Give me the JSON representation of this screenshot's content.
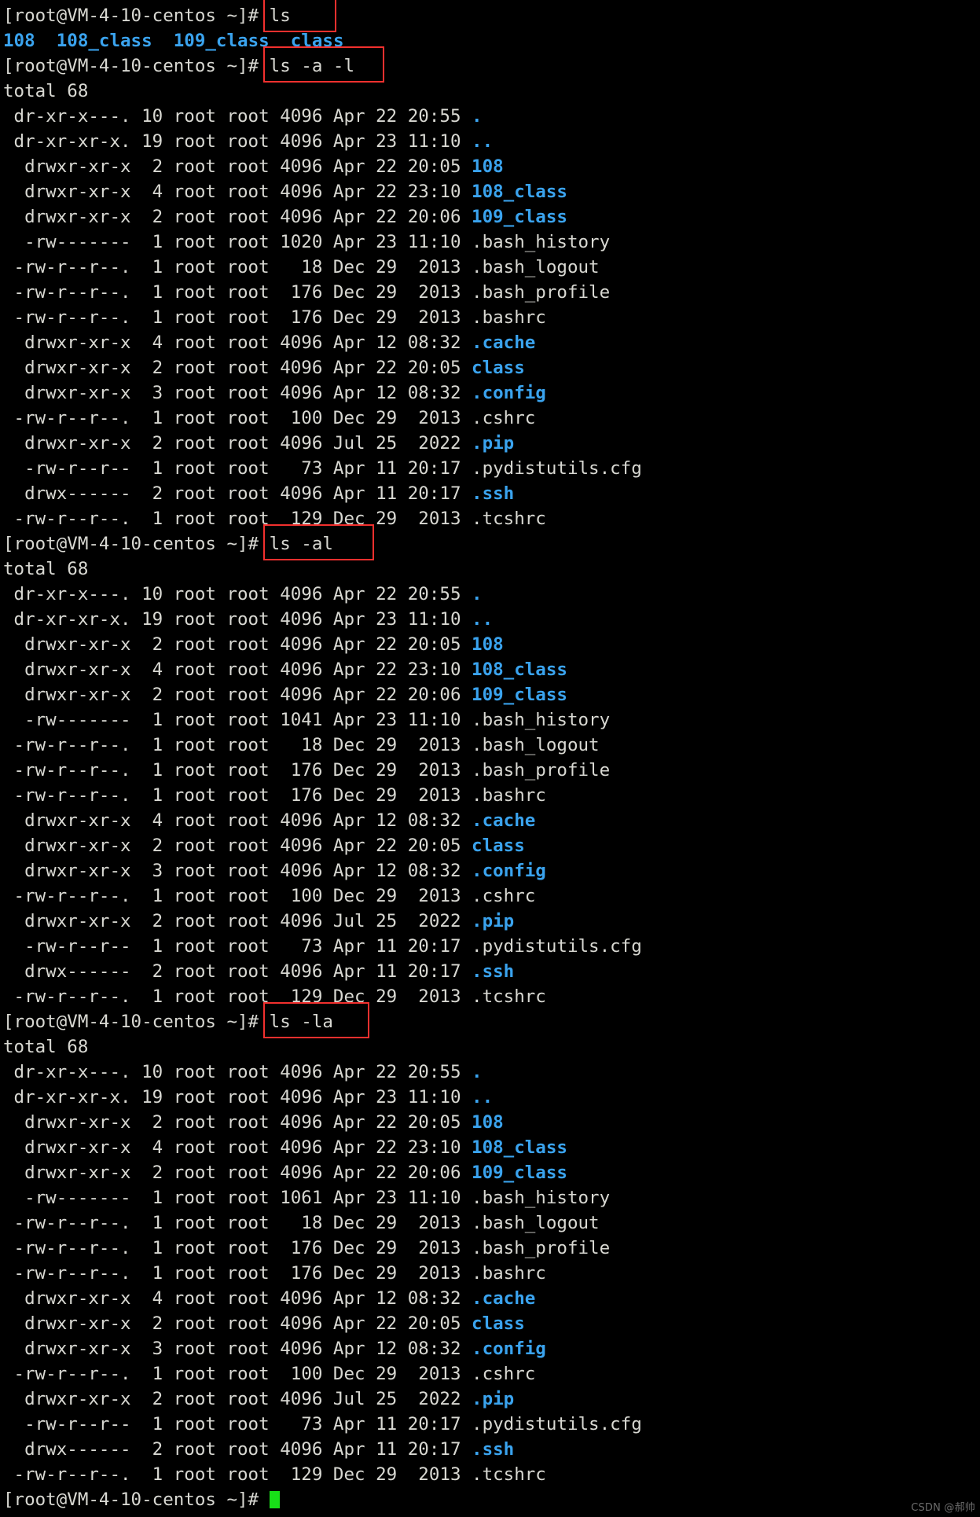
{
  "terminal": {
    "prompt": "[root@VM-4-10-centos ~]# ",
    "colors": {
      "background": "#000000",
      "foreground": "#d8d8d2",
      "directory": "#3aa3ee",
      "annotation_box": "#f2302e",
      "cursor": "#18e018"
    },
    "watermark": "CSDN @郝帅",
    "blocks": [
      {
        "command": "ls",
        "boxed": true,
        "output": [
          {
            "type": "names",
            "items": [
              {
                "text": "108",
                "dir": true
              },
              {
                "text": "108_class",
                "dir": true
              },
              {
                "text": "109_class",
                "dir": true
              },
              {
                "text": "class",
                "dir": true
              }
            ]
          }
        ]
      },
      {
        "command": "ls -a -l",
        "boxed": true,
        "total": "total 68",
        "rows": [
          {
            "perm": "dr-xr-x---.",
            "links": "10",
            "user": "root",
            "group": "root",
            "size": "4096",
            "month": "Apr",
            "day": "22",
            "time": "20:55",
            "name": ".",
            "dir": true
          },
          {
            "perm": "dr-xr-xr-x.",
            "links": "19",
            "user": "root",
            "group": "root",
            "size": "4096",
            "month": "Apr",
            "day": "23",
            "time": "11:10",
            "name": "..",
            "dir": true
          },
          {
            "perm": "drwxr-xr-x",
            "links": "2",
            "user": "root",
            "group": "root",
            "size": "4096",
            "month": "Apr",
            "day": "22",
            "time": "20:05",
            "name": "108",
            "dir": true
          },
          {
            "perm": "drwxr-xr-x",
            "links": "4",
            "user": "root",
            "group": "root",
            "size": "4096",
            "month": "Apr",
            "day": "22",
            "time": "23:10",
            "name": "108_class",
            "dir": true
          },
          {
            "perm": "drwxr-xr-x",
            "links": "2",
            "user": "root",
            "group": "root",
            "size": "4096",
            "month": "Apr",
            "day": "22",
            "time": "20:06",
            "name": "109_class",
            "dir": true
          },
          {
            "perm": "-rw-------",
            "links": "1",
            "user": "root",
            "group": "root",
            "size": "1020",
            "month": "Apr",
            "day": "23",
            "time": "11:10",
            "name": ".bash_history",
            "dir": false
          },
          {
            "perm": "-rw-r--r--.",
            "links": "1",
            "user": "root",
            "group": "root",
            "size": "18",
            "month": "Dec",
            "day": "29",
            "time": "2013",
            "name": ".bash_logout",
            "dir": false
          },
          {
            "perm": "-rw-r--r--.",
            "links": "1",
            "user": "root",
            "group": "root",
            "size": "176",
            "month": "Dec",
            "day": "29",
            "time": "2013",
            "name": ".bash_profile",
            "dir": false
          },
          {
            "perm": "-rw-r--r--.",
            "links": "1",
            "user": "root",
            "group": "root",
            "size": "176",
            "month": "Dec",
            "day": "29",
            "time": "2013",
            "name": ".bashrc",
            "dir": false
          },
          {
            "perm": "drwxr-xr-x",
            "links": "4",
            "user": "root",
            "group": "root",
            "size": "4096",
            "month": "Apr",
            "day": "12",
            "time": "08:32",
            "name": ".cache",
            "dir": true
          },
          {
            "perm": "drwxr-xr-x",
            "links": "2",
            "user": "root",
            "group": "root",
            "size": "4096",
            "month": "Apr",
            "day": "22",
            "time": "20:05",
            "name": "class",
            "dir": true
          },
          {
            "perm": "drwxr-xr-x",
            "links": "3",
            "user": "root",
            "group": "root",
            "size": "4096",
            "month": "Apr",
            "day": "12",
            "time": "08:32",
            "name": ".config",
            "dir": true
          },
          {
            "perm": "-rw-r--r--.",
            "links": "1",
            "user": "root",
            "group": "root",
            "size": "100",
            "month": "Dec",
            "day": "29",
            "time": "2013",
            "name": ".cshrc",
            "dir": false
          },
          {
            "perm": "drwxr-xr-x",
            "links": "2",
            "user": "root",
            "group": "root",
            "size": "4096",
            "month": "Jul",
            "day": "25",
            "time": "2022",
            "name": ".pip",
            "dir": true
          },
          {
            "perm": "-rw-r--r--",
            "links": "1",
            "user": "root",
            "group": "root",
            "size": "73",
            "month": "Apr",
            "day": "11",
            "time": "20:17",
            "name": ".pydistutils.cfg",
            "dir": false
          },
          {
            "perm": "drwx------",
            "links": "2",
            "user": "root",
            "group": "root",
            "size": "4096",
            "month": "Apr",
            "day": "11",
            "time": "20:17",
            "name": ".ssh",
            "dir": true
          },
          {
            "perm": "-rw-r--r--.",
            "links": "1",
            "user": "root",
            "group": "root",
            "size": "129",
            "month": "Dec",
            "day": "29",
            "time": "2013",
            "name": ".tcshrc",
            "dir": false
          }
        ]
      },
      {
        "command": "ls -al",
        "boxed": true,
        "total": "total 68",
        "rows": [
          {
            "perm": "dr-xr-x---.",
            "links": "10",
            "user": "root",
            "group": "root",
            "size": "4096",
            "month": "Apr",
            "day": "22",
            "time": "20:55",
            "name": ".",
            "dir": true
          },
          {
            "perm": "dr-xr-xr-x.",
            "links": "19",
            "user": "root",
            "group": "root",
            "size": "4096",
            "month": "Apr",
            "day": "23",
            "time": "11:10",
            "name": "..",
            "dir": true
          },
          {
            "perm": "drwxr-xr-x",
            "links": "2",
            "user": "root",
            "group": "root",
            "size": "4096",
            "month": "Apr",
            "day": "22",
            "time": "20:05",
            "name": "108",
            "dir": true
          },
          {
            "perm": "drwxr-xr-x",
            "links": "4",
            "user": "root",
            "group": "root",
            "size": "4096",
            "month": "Apr",
            "day": "22",
            "time": "23:10",
            "name": "108_class",
            "dir": true
          },
          {
            "perm": "drwxr-xr-x",
            "links": "2",
            "user": "root",
            "group": "root",
            "size": "4096",
            "month": "Apr",
            "day": "22",
            "time": "20:06",
            "name": "109_class",
            "dir": true
          },
          {
            "perm": "-rw-------",
            "links": "1",
            "user": "root",
            "group": "root",
            "size": "1041",
            "month": "Apr",
            "day": "23",
            "time": "11:10",
            "name": ".bash_history",
            "dir": false
          },
          {
            "perm": "-rw-r--r--.",
            "links": "1",
            "user": "root",
            "group": "root",
            "size": "18",
            "month": "Dec",
            "day": "29",
            "time": "2013",
            "name": ".bash_logout",
            "dir": false
          },
          {
            "perm": "-rw-r--r--.",
            "links": "1",
            "user": "root",
            "group": "root",
            "size": "176",
            "month": "Dec",
            "day": "29",
            "time": "2013",
            "name": ".bash_profile",
            "dir": false
          },
          {
            "perm": "-rw-r--r--.",
            "links": "1",
            "user": "root",
            "group": "root",
            "size": "176",
            "month": "Dec",
            "day": "29",
            "time": "2013",
            "name": ".bashrc",
            "dir": false
          },
          {
            "perm": "drwxr-xr-x",
            "links": "4",
            "user": "root",
            "group": "root",
            "size": "4096",
            "month": "Apr",
            "day": "12",
            "time": "08:32",
            "name": ".cache",
            "dir": true
          },
          {
            "perm": "drwxr-xr-x",
            "links": "2",
            "user": "root",
            "group": "root",
            "size": "4096",
            "month": "Apr",
            "day": "22",
            "time": "20:05",
            "name": "class",
            "dir": true
          },
          {
            "perm": "drwxr-xr-x",
            "links": "3",
            "user": "root",
            "group": "root",
            "size": "4096",
            "month": "Apr",
            "day": "12",
            "time": "08:32",
            "name": ".config",
            "dir": true
          },
          {
            "perm": "-rw-r--r--.",
            "links": "1",
            "user": "root",
            "group": "root",
            "size": "100",
            "month": "Dec",
            "day": "29",
            "time": "2013",
            "name": ".cshrc",
            "dir": false
          },
          {
            "perm": "drwxr-xr-x",
            "links": "2",
            "user": "root",
            "group": "root",
            "size": "4096",
            "month": "Jul",
            "day": "25",
            "time": "2022",
            "name": ".pip",
            "dir": true
          },
          {
            "perm": "-rw-r--r--",
            "links": "1",
            "user": "root",
            "group": "root",
            "size": "73",
            "month": "Apr",
            "day": "11",
            "time": "20:17",
            "name": ".pydistutils.cfg",
            "dir": false
          },
          {
            "perm": "drwx------",
            "links": "2",
            "user": "root",
            "group": "root",
            "size": "4096",
            "month": "Apr",
            "day": "11",
            "time": "20:17",
            "name": ".ssh",
            "dir": true
          },
          {
            "perm": "-rw-r--r--.",
            "links": "1",
            "user": "root",
            "group": "root",
            "size": "129",
            "month": "Dec",
            "day": "29",
            "time": "2013",
            "name": ".tcshrc",
            "dir": false
          }
        ]
      },
      {
        "command": "ls -la",
        "boxed": true,
        "total": "total 68",
        "rows": [
          {
            "perm": "dr-xr-x---.",
            "links": "10",
            "user": "root",
            "group": "root",
            "size": "4096",
            "month": "Apr",
            "day": "22",
            "time": "20:55",
            "name": ".",
            "dir": true
          },
          {
            "perm": "dr-xr-xr-x.",
            "links": "19",
            "user": "root",
            "group": "root",
            "size": "4096",
            "month": "Apr",
            "day": "23",
            "time": "11:10",
            "name": "..",
            "dir": true
          },
          {
            "perm": "drwxr-xr-x",
            "links": "2",
            "user": "root",
            "group": "root",
            "size": "4096",
            "month": "Apr",
            "day": "22",
            "time": "20:05",
            "name": "108",
            "dir": true
          },
          {
            "perm": "drwxr-xr-x",
            "links": "4",
            "user": "root",
            "group": "root",
            "size": "4096",
            "month": "Apr",
            "day": "22",
            "time": "23:10",
            "name": "108_class",
            "dir": true
          },
          {
            "perm": "drwxr-xr-x",
            "links": "2",
            "user": "root",
            "group": "root",
            "size": "4096",
            "month": "Apr",
            "day": "22",
            "time": "20:06",
            "name": "109_class",
            "dir": true
          },
          {
            "perm": "-rw-------",
            "links": "1",
            "user": "root",
            "group": "root",
            "size": "1061",
            "month": "Apr",
            "day": "23",
            "time": "11:10",
            "name": ".bash_history",
            "dir": false
          },
          {
            "perm": "-rw-r--r--.",
            "links": "1",
            "user": "root",
            "group": "root",
            "size": "18",
            "month": "Dec",
            "day": "29",
            "time": "2013",
            "name": ".bash_logout",
            "dir": false
          },
          {
            "perm": "-rw-r--r--.",
            "links": "1",
            "user": "root",
            "group": "root",
            "size": "176",
            "month": "Dec",
            "day": "29",
            "time": "2013",
            "name": ".bash_profile",
            "dir": false
          },
          {
            "perm": "-rw-r--r--.",
            "links": "1",
            "user": "root",
            "group": "root",
            "size": "176",
            "month": "Dec",
            "day": "29",
            "time": "2013",
            "name": ".bashrc",
            "dir": false
          },
          {
            "perm": "drwxr-xr-x",
            "links": "4",
            "user": "root",
            "group": "root",
            "size": "4096",
            "month": "Apr",
            "day": "12",
            "time": "08:32",
            "name": ".cache",
            "dir": true
          },
          {
            "perm": "drwxr-xr-x",
            "links": "2",
            "user": "root",
            "group": "root",
            "size": "4096",
            "month": "Apr",
            "day": "22",
            "time": "20:05",
            "name": "class",
            "dir": true
          },
          {
            "perm": "drwxr-xr-x",
            "links": "3",
            "user": "root",
            "group": "root",
            "size": "4096",
            "month": "Apr",
            "day": "12",
            "time": "08:32",
            "name": ".config",
            "dir": true
          },
          {
            "perm": "-rw-r--r--.",
            "links": "1",
            "user": "root",
            "group": "root",
            "size": "100",
            "month": "Dec",
            "day": "29",
            "time": "2013",
            "name": ".cshrc",
            "dir": false
          },
          {
            "perm": "drwxr-xr-x",
            "links": "2",
            "user": "root",
            "group": "root",
            "size": "4096",
            "month": "Jul",
            "day": "25",
            "time": "2022",
            "name": ".pip",
            "dir": true
          },
          {
            "perm": "-rw-r--r--",
            "links": "1",
            "user": "root",
            "group": "root",
            "size": "73",
            "month": "Apr",
            "day": "11",
            "time": "20:17",
            "name": ".pydistutils.cfg",
            "dir": false
          },
          {
            "perm": "drwx------",
            "links": "2",
            "user": "root",
            "group": "root",
            "size": "4096",
            "month": "Apr",
            "day": "11",
            "time": "20:17",
            "name": ".ssh",
            "dir": true
          },
          {
            "perm": "-rw-r--r--.",
            "links": "1",
            "user": "root",
            "group": "root",
            "size": "129",
            "month": "Dec",
            "day": "29",
            "time": "2013",
            "name": ".tcshrc",
            "dir": false
          }
        ]
      }
    ],
    "final_prompt_has_cursor": true
  }
}
